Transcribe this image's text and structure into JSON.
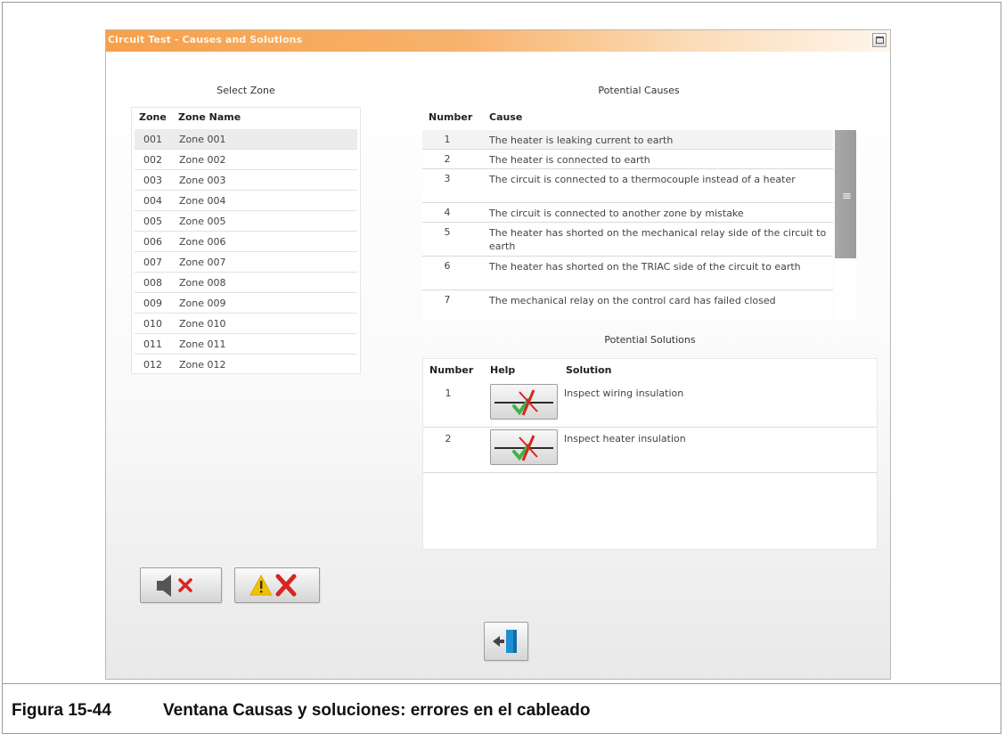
{
  "window": {
    "title": "Circuit Test - Causes and Solutions"
  },
  "select_zone": {
    "caption": "Select Zone",
    "headers": {
      "zone": "Zone",
      "name": "Zone Name"
    },
    "rows": [
      {
        "zone": "001",
        "name": "Zone 001"
      },
      {
        "zone": "002",
        "name": "Zone 002"
      },
      {
        "zone": "003",
        "name": "Zone 003"
      },
      {
        "zone": "004",
        "name": "Zone 004"
      },
      {
        "zone": "005",
        "name": "Zone 005"
      },
      {
        "zone": "006",
        "name": "Zone 006"
      },
      {
        "zone": "007",
        "name": "Zone 007"
      },
      {
        "zone": "008",
        "name": "Zone 008"
      },
      {
        "zone": "009",
        "name": "Zone 009"
      },
      {
        "zone": "010",
        "name": "Zone 010"
      },
      {
        "zone": "011",
        "name": "Zone 011"
      },
      {
        "zone": "012",
        "name": "Zone 012"
      }
    ]
  },
  "causes": {
    "caption": "Potential Causes",
    "headers": {
      "number": "Number",
      "cause": "Cause"
    },
    "rows": [
      {
        "number": "1",
        "cause": "The heater is leaking current to earth"
      },
      {
        "number": "2",
        "cause": "The heater is connected to earth"
      },
      {
        "number": "3",
        "cause": "The circuit is connected to a thermocouple instead of a heater"
      },
      {
        "number": "4",
        "cause": "The circuit is connected to another zone by mistake"
      },
      {
        "number": "5",
        "cause": "The heater has shorted on the mechanical relay side of the circuit to earth"
      },
      {
        "number": "6",
        "cause": "The heater has shorted on the TRIAC side of the circuit to earth"
      },
      {
        "number": "7",
        "cause": "The mechanical relay on the control card has failed closed"
      }
    ]
  },
  "solutions": {
    "caption": "Potential Solutions",
    "headers": {
      "number": "Number",
      "help": "Help",
      "solution": "Solution"
    },
    "rows": [
      {
        "number": "1",
        "solution": "Inspect wiring insulation",
        "help_icon": "wiring-fault-icon"
      },
      {
        "number": "2",
        "solution": "Inspect heater insulation",
        "help_icon": "wiring-fault-icon"
      }
    ]
  },
  "icons": {
    "mute_alarm": "speaker-mute-icon",
    "clear_warning": "warning-clear-icon",
    "exit": "exit-door-icon",
    "minimize": "minimize-window-icon"
  },
  "colors": {
    "title_bar": "#f6a04a",
    "error_red": "#d7261f",
    "warning_yellow": "#f2c200",
    "ok_green": "#3cb44a",
    "exit_blue": "#1f8fd1"
  },
  "figure": {
    "label": "Figura 15-44",
    "text": "Ventana Causas y soluciones: errores en el cableado"
  }
}
